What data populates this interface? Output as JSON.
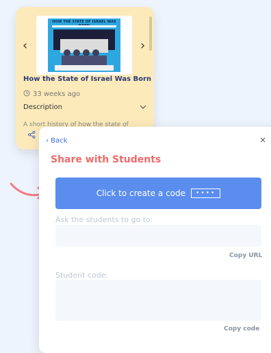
{
  "video": {
    "thumbnail_caption": "HOW THE STATE OF ISRAEL WAS BORN",
    "title": "How the State of Israel Was Born",
    "age": "33 weeks ago",
    "description_label": "Description",
    "description_text": "A short history of how the state of"
  },
  "share": {
    "back_label": "‹ Back",
    "close_label": "×",
    "title": "Share with Students",
    "create_code_label": "Click to create a code",
    "code_dots": "••••",
    "goto_label": "Ask the students to go to:",
    "copy_url_label": "Copy URL",
    "student_code_label": "Student code:",
    "copy_code_label": "Copy code"
  },
  "colors": {
    "card_bg": "#fceaba",
    "accent_blue": "#5b8def",
    "title_red": "#f06a6a",
    "arrow_red": "#f27b84"
  },
  "icons": {
    "left": "chevron-left-icon",
    "right": "chevron-right-icon",
    "clock": "clock-icon",
    "chevron_down": "chevron-down-icon",
    "share": "share-icon",
    "close": "close-icon",
    "pointer": "curved-arrow-icon"
  }
}
